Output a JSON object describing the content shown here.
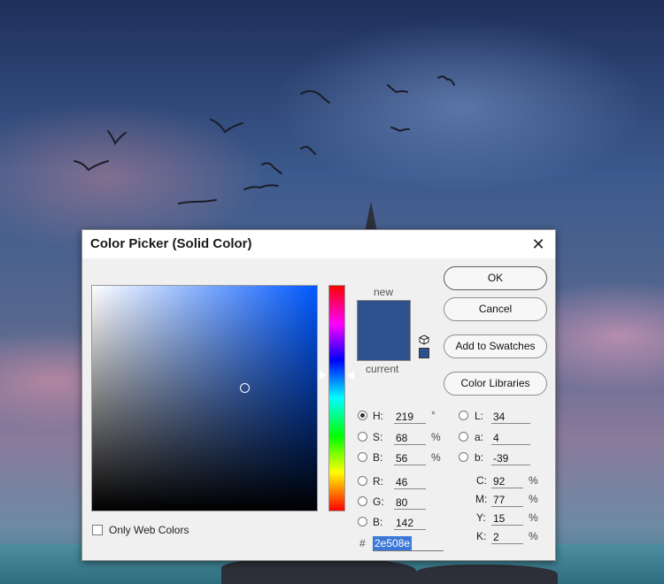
{
  "dialog": {
    "title": "Color Picker (Solid Color)",
    "close_icon": "close-icon",
    "new_label": "new",
    "current_label": "current",
    "new_color": "#2e508e",
    "gamut_icon": "cube-icon",
    "websafe_icon": "websafe-square-icon"
  },
  "buttons": {
    "ok": "OK",
    "cancel": "Cancel",
    "add_to_swatches": "Add to Swatches",
    "color_libraries": "Color Libraries"
  },
  "hsb": [
    {
      "label": "H:",
      "value": "219",
      "unit": "°",
      "selected": true
    },
    {
      "label": "S:",
      "value": "68",
      "unit": "%",
      "selected": false
    },
    {
      "label": "B:",
      "value": "56",
      "unit": "%",
      "selected": false
    }
  ],
  "rgb": [
    {
      "label": "R:",
      "value": "46"
    },
    {
      "label": "G:",
      "value": "80"
    },
    {
      "label": "B:",
      "value": "142"
    }
  ],
  "lab": [
    {
      "label": "L:",
      "value": "34"
    },
    {
      "label": "a:",
      "value": "4"
    },
    {
      "label": "b:",
      "value": "-39"
    }
  ],
  "cmyk": [
    {
      "label": "C:",
      "value": "92",
      "unit": "%"
    },
    {
      "label": "M:",
      "value": "77",
      "unit": "%"
    },
    {
      "label": "Y:",
      "value": "15",
      "unit": "%"
    },
    {
      "label": "K:",
      "value": "2",
      "unit": "%"
    }
  ],
  "only_web_colors": {
    "label": "Only Web Colors",
    "checked": false
  },
  "hex": {
    "prefix": "#",
    "value": "2e508e"
  }
}
